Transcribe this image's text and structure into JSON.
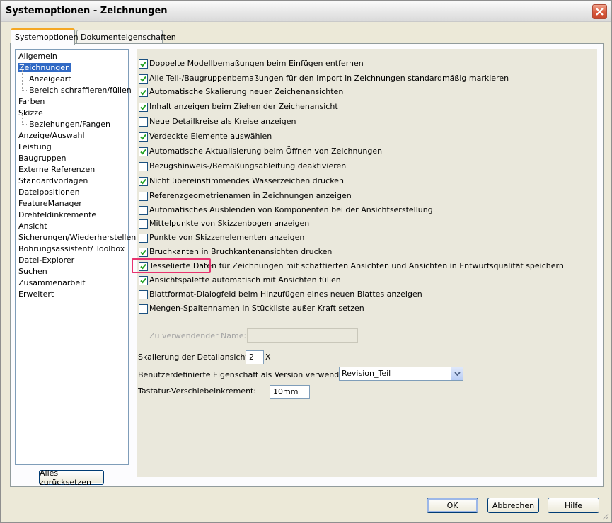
{
  "window": {
    "title": "Systemoptionen - Zeichnungen"
  },
  "tabs": [
    {
      "label": "Systemoptionen",
      "active": true
    },
    {
      "label": "Dokumenteigenschaften",
      "active": false
    }
  ],
  "tree": {
    "items": [
      {
        "label": "Allgemein",
        "level": 0
      },
      {
        "label": "Zeichnungen",
        "level": 0,
        "selected": true
      },
      {
        "label": "Anzeigeart",
        "level": 1
      },
      {
        "label": "Bereich schraffieren/füllen",
        "level": 1
      },
      {
        "label": "Farben",
        "level": 0
      },
      {
        "label": "Skizze",
        "level": 0
      },
      {
        "label": "Beziehungen/Fangen",
        "level": 1
      },
      {
        "label": "Anzeige/Auswahl",
        "level": 0
      },
      {
        "label": "Leistung",
        "level": 0
      },
      {
        "label": "Baugruppen",
        "level": 0
      },
      {
        "label": "Externe Referenzen",
        "level": 0
      },
      {
        "label": "Standardvorlagen",
        "level": 0
      },
      {
        "label": "Dateipositionen",
        "level": 0
      },
      {
        "label": "FeatureManager",
        "level": 0
      },
      {
        "label": "Drehfeldinkremente",
        "level": 0
      },
      {
        "label": "Ansicht",
        "level": 0
      },
      {
        "label": "Sicherungen/Wiederherstellen",
        "level": 0
      },
      {
        "label": "Bohrungsassistent/ Toolbox",
        "level": 0
      },
      {
        "label": "Datei-Explorer",
        "level": 0
      },
      {
        "label": "Suchen",
        "level": 0
      },
      {
        "label": "Zusammenarbeit",
        "level": 0
      },
      {
        "label": "Erweitert",
        "level": 0
      }
    ],
    "reset_label": "Alles zurücksetzen"
  },
  "options": [
    {
      "label": "Doppelte Modellbemaßungen beim Einfügen entfernen",
      "checked": true
    },
    {
      "label": "Alle Teil-/Baugruppenbemaßungen für den Import in Zeichnungen standardmäßig markieren",
      "checked": true
    },
    {
      "label": "Automatische Skalierung neuer Zeichenansichten",
      "checked": true
    },
    {
      "label": "Inhalt anzeigen beim Ziehen der Zeichenansicht",
      "checked": true
    },
    {
      "label": "Neue Detailkreise als Kreise anzeigen",
      "checked": false
    },
    {
      "label": "Verdeckte Elemente auswählen",
      "checked": true
    },
    {
      "label": "Automatische Aktualisierung beim Öffnen von Zeichnungen",
      "checked": true
    },
    {
      "label": "Bezugshinweis-/Bemaßungsableitung deaktivieren",
      "checked": false
    },
    {
      "label": "Nicht übereinstimmendes Wasserzeichen drucken",
      "checked": true
    },
    {
      "label": "Referenzgeometrienamen in Zeichnungen anzeigen",
      "checked": false
    },
    {
      "label": "Automatisches Ausblenden von Komponenten bei der Ansichtserstellung",
      "checked": false
    },
    {
      "label": "Mittelpunkte von Skizzenbogen anzeigen",
      "checked": false
    },
    {
      "label": "Punkte von Skizzenelementen anzeigen",
      "checked": false
    },
    {
      "label": "Bruchkanten in Bruchkantenansichten drucken",
      "checked": true
    },
    {
      "label": "Tesselierte Daten für Zeichnungen mit schattierten Ansichten und Ansichten in Entwurfsqualität speichern",
      "checked": true
    },
    {
      "label": "Ansichtspalette automatisch mit Ansichten füllen",
      "checked": true
    },
    {
      "label": "Blattformat-Dialogfeld beim Hinzufügen eines neuen Blattes anzeigen",
      "checked": false
    },
    {
      "label": "Mengen-Spaltennamen in Stückliste außer Kraft setzen",
      "checked": false
    }
  ],
  "fields": {
    "name_label": "Zu verwendender Name:",
    "name_value": "",
    "detail_scale_label": "Skalierung der Detailansicht:",
    "detail_scale_value": "2",
    "detail_scale_unit": "X",
    "version_prop_label": "Benutzerdefinierte Eigenschaft als Version verwendet:",
    "version_prop_value": "Revision_Teil",
    "keyboard_step_label": "Tastatur-Verschiebeinkrement:",
    "keyboard_step_value": "10mm"
  },
  "buttons": {
    "ok": "OK",
    "cancel": "Abbrechen",
    "help": "Hilfe"
  },
  "colors": {
    "highlight": "#e8336f",
    "selection": "#316ac5",
    "checkmark": "#21a121"
  }
}
